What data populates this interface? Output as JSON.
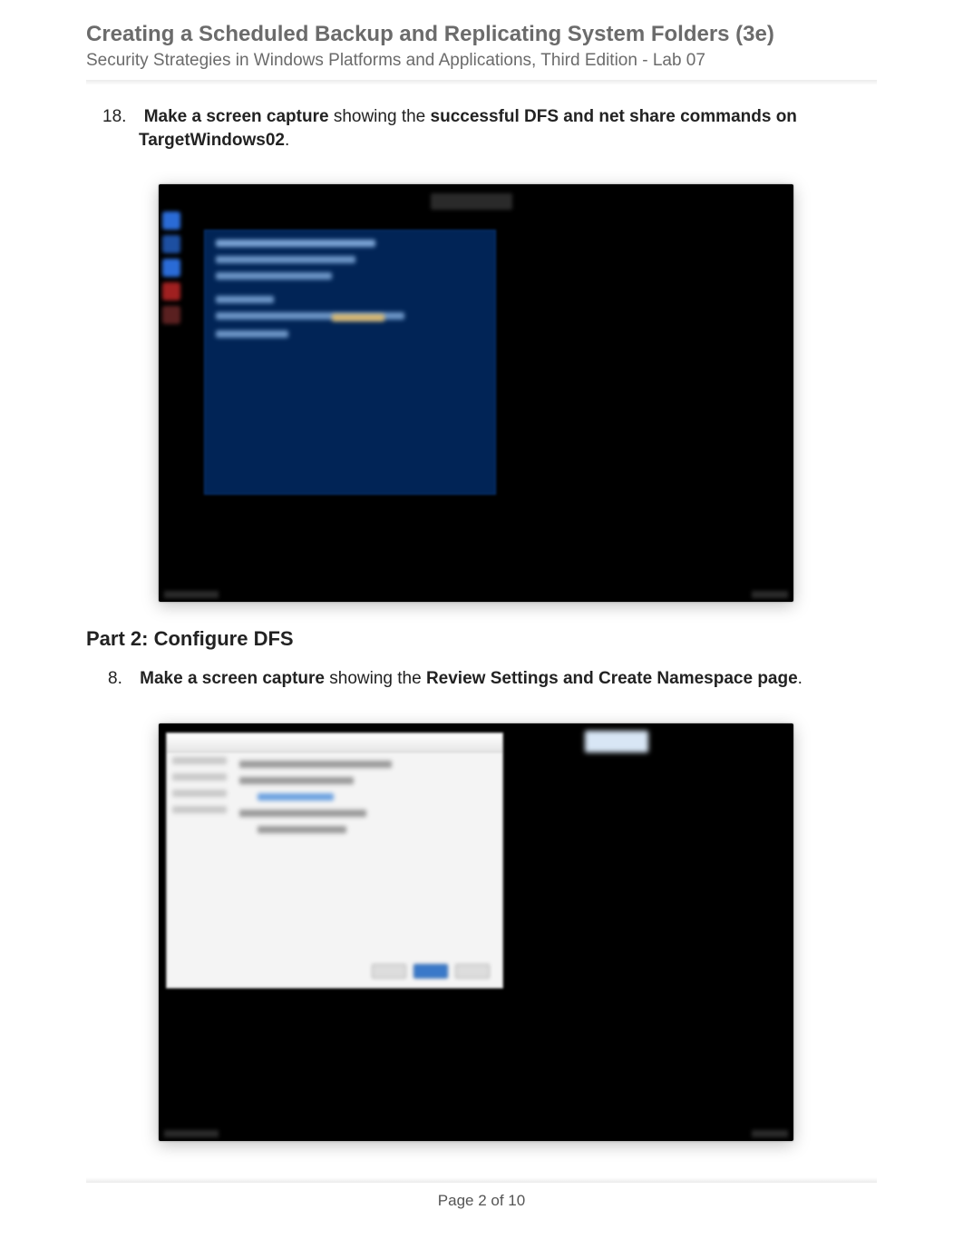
{
  "header": {
    "title": "Creating a Scheduled Backup and Replicating System Folders (3e)",
    "subtitle": "Security Strategies in Windows Platforms and Applications, Third Edition - Lab 07"
  },
  "step18": {
    "number": "18.",
    "bold_prefix": "Make a screen capture",
    "middle": " showing the ",
    "bold_suffix": "successful DFS and net share commands on TargetWindows02",
    "period": "."
  },
  "part2_heading": "Part 2: Configure DFS",
  "step8": {
    "number": "8.",
    "bold_prefix": "Make a screen capture",
    "middle": " showing the ",
    "bold_suffix": "Review Settings and Create Namespace page",
    "period": "."
  },
  "footer": {
    "page_label": "Page 2 of 10"
  }
}
